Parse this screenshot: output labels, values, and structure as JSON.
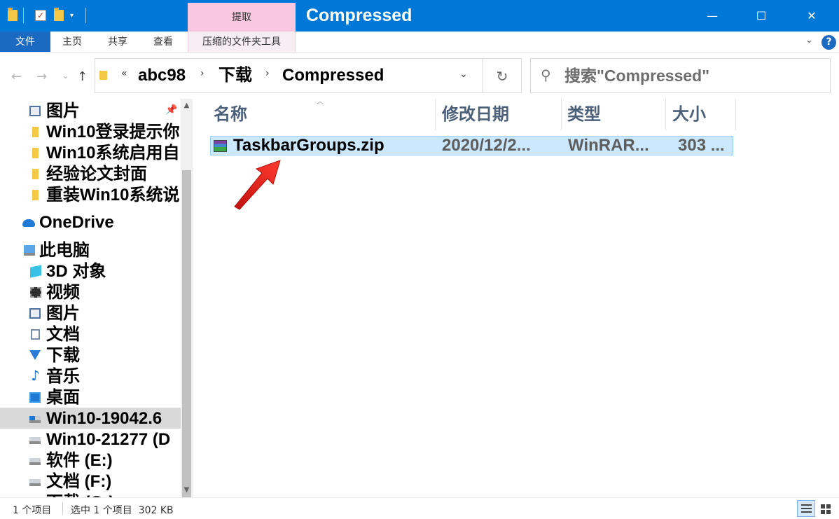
{
  "window": {
    "title": "Compressed",
    "context_tab": "提取",
    "controls": {
      "minimize": "—",
      "maximize": "☐",
      "close": "✕"
    }
  },
  "ribbon": {
    "tabs": [
      "文件",
      "主页",
      "共享",
      "查看"
    ],
    "tools_tab": "压缩的文件夹工具",
    "expand": "⌄",
    "help": "?"
  },
  "nav_buttons": {
    "back": "←",
    "forward": "→",
    "recent": "⌄",
    "up": "↑"
  },
  "address": {
    "overflow": "«",
    "crumbs": [
      "abc98",
      "下载",
      "Compressed"
    ],
    "separator": "›",
    "dropdown": "⌄",
    "refresh": "↻"
  },
  "search": {
    "placeholder": "搜索\"Compressed\"",
    "icon": "search-icon"
  },
  "nav_pane": {
    "items": [
      {
        "label": "图片",
        "icon": "pictures-icon",
        "pinned": true
      },
      {
        "label": "Win10登录提示你",
        "icon": "folder-icon"
      },
      {
        "label": "Win10系统启用自",
        "icon": "folder-icon"
      },
      {
        "label": "经验论文封面",
        "icon": "folder-icon"
      },
      {
        "label": "重装Win10系统说",
        "icon": "folder-icon"
      },
      {
        "label": "OneDrive",
        "icon": "onedrive-icon"
      },
      {
        "label": "此电脑",
        "icon": "this-pc-icon"
      },
      {
        "label": "3D 对象",
        "icon": "3d-objects-icon"
      },
      {
        "label": "视频",
        "icon": "videos-icon"
      },
      {
        "label": "图片",
        "icon": "pictures-icon"
      },
      {
        "label": "文档",
        "icon": "documents-icon"
      },
      {
        "label": "下载",
        "icon": "downloads-icon"
      },
      {
        "label": "音乐",
        "icon": "music-icon"
      },
      {
        "label": "桌面",
        "icon": "desktop-icon"
      },
      {
        "label": "Win10-19042.6",
        "icon": "system-drive-icon",
        "selected": true
      },
      {
        "label": "Win10-21277 (D",
        "icon": "drive-icon"
      },
      {
        "label": "软件 (E:)",
        "icon": "drive-icon"
      },
      {
        "label": "文档 (F:)",
        "icon": "drive-icon"
      },
      {
        "label": "下载 (G:)",
        "icon": "drive-icon"
      }
    ],
    "pin_glyph": "📌"
  },
  "columns": [
    "名称",
    "修改日期",
    "类型",
    "大小"
  ],
  "files": [
    {
      "name": "TaskbarGroups.zip",
      "modified": "2020/12/2...",
      "type": "WinRAR...",
      "size": "303 ..."
    }
  ],
  "status": {
    "count": "1 个项目",
    "selection": "选中 1 个项目  302 KB"
  },
  "colors": {
    "titlebar": "#0078d7",
    "context_tab": "#f8c8e0",
    "selection": "#cce8ff",
    "arrow": "#e8201c"
  }
}
